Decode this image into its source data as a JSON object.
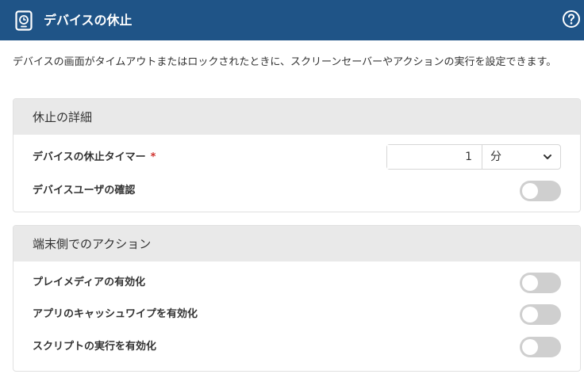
{
  "header": {
    "title": "デバイスの休止",
    "icon": "device-clock-icon",
    "help_icon": "help-circle-icon",
    "bg_color": "#1f5487"
  },
  "description": "デバイスの画面がタイムアウトまたはロックされたときに、スクリーンセーバーやアクションの実行を設定できます。",
  "sections": [
    {
      "title": "休止の詳細",
      "rows": [
        {
          "label": "デバイスの休止タイマー",
          "required_mark": "*",
          "control": "number-select",
          "value": "1",
          "unit": "分"
        },
        {
          "label": "デバイスユーザの確認",
          "control": "toggle",
          "enabled": false
        }
      ]
    },
    {
      "title": "端末側でのアクション",
      "rows": [
        {
          "label": "プレイメディアの有効化",
          "control": "toggle",
          "enabled": false
        },
        {
          "label": "アプリのキャッシュワイプを有効化",
          "control": "toggle",
          "enabled": false
        },
        {
          "label": "スクリプトの実行を有効化",
          "control": "toggle",
          "enabled": false
        }
      ]
    }
  ]
}
